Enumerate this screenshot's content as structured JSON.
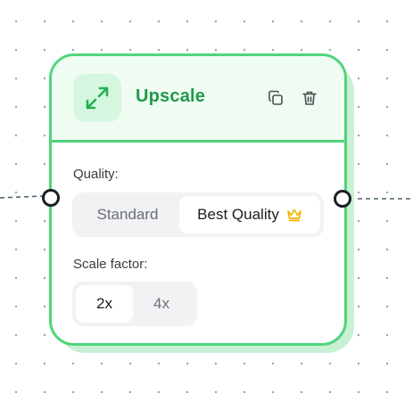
{
  "node": {
    "title": "Upscale",
    "icon": "expand-arrows-icon",
    "accent_color": "#4fd47b",
    "title_color": "#1f9a4a",
    "actions": [
      {
        "name": "copy",
        "icon": "copy-icon"
      },
      {
        "name": "delete",
        "icon": "trash-icon"
      }
    ],
    "quality": {
      "label": "Quality:",
      "options": [
        "Standard",
        "Best Quality"
      ],
      "selected": "Best Quality",
      "premium_icon": "crown-icon",
      "premium_color": "#f2b600"
    },
    "scale": {
      "label": "Scale factor:",
      "options": [
        "2x",
        "4x"
      ],
      "selected": "2x"
    }
  }
}
